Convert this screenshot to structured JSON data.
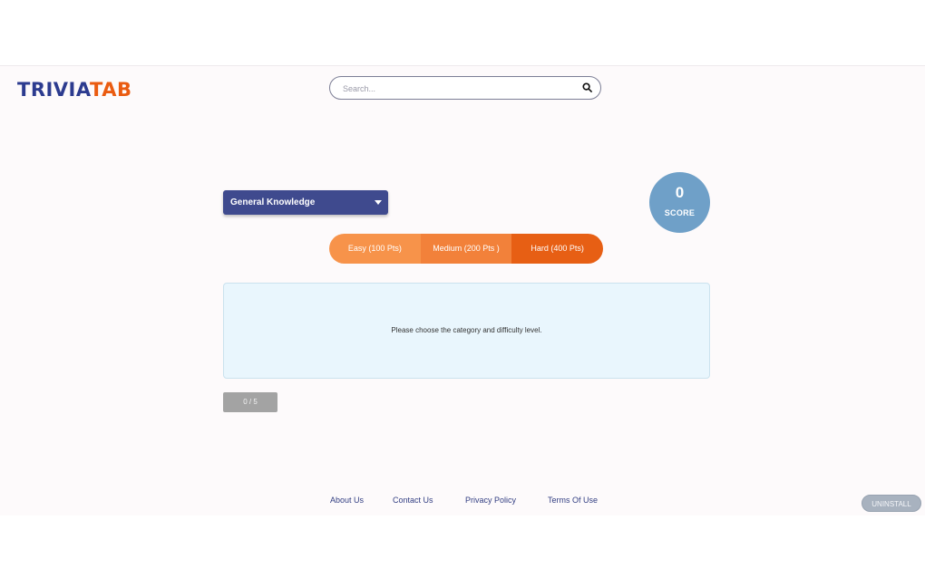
{
  "brand": {
    "logo_part1": "TRIVIA",
    "logo_part2": "TAB",
    "color_primary": "#2c3b8f",
    "color_accent": "#ea5b10"
  },
  "search": {
    "placeholder": "Search...",
    "value": "",
    "icon": "search-icon"
  },
  "category": {
    "selected": "General Knowledge",
    "icon": "caret-down-icon"
  },
  "score": {
    "value": "0",
    "label": "SCORE"
  },
  "difficulty": [
    {
      "label": "Easy (100 Pts)"
    },
    {
      "label": "Medium (200 Pts )"
    },
    {
      "label": "Hard (400 Pts)"
    }
  ],
  "message": "Please choose the category and difficulty level.",
  "progress": {
    "text": "0 / 5"
  },
  "footer": {
    "links": [
      {
        "label": "About Us"
      },
      {
        "label": "Contact Us"
      },
      {
        "label": "Privacy Policy"
      },
      {
        "label": "Terms Of Use"
      }
    ],
    "uninstall_label": "UNINSTALL"
  }
}
